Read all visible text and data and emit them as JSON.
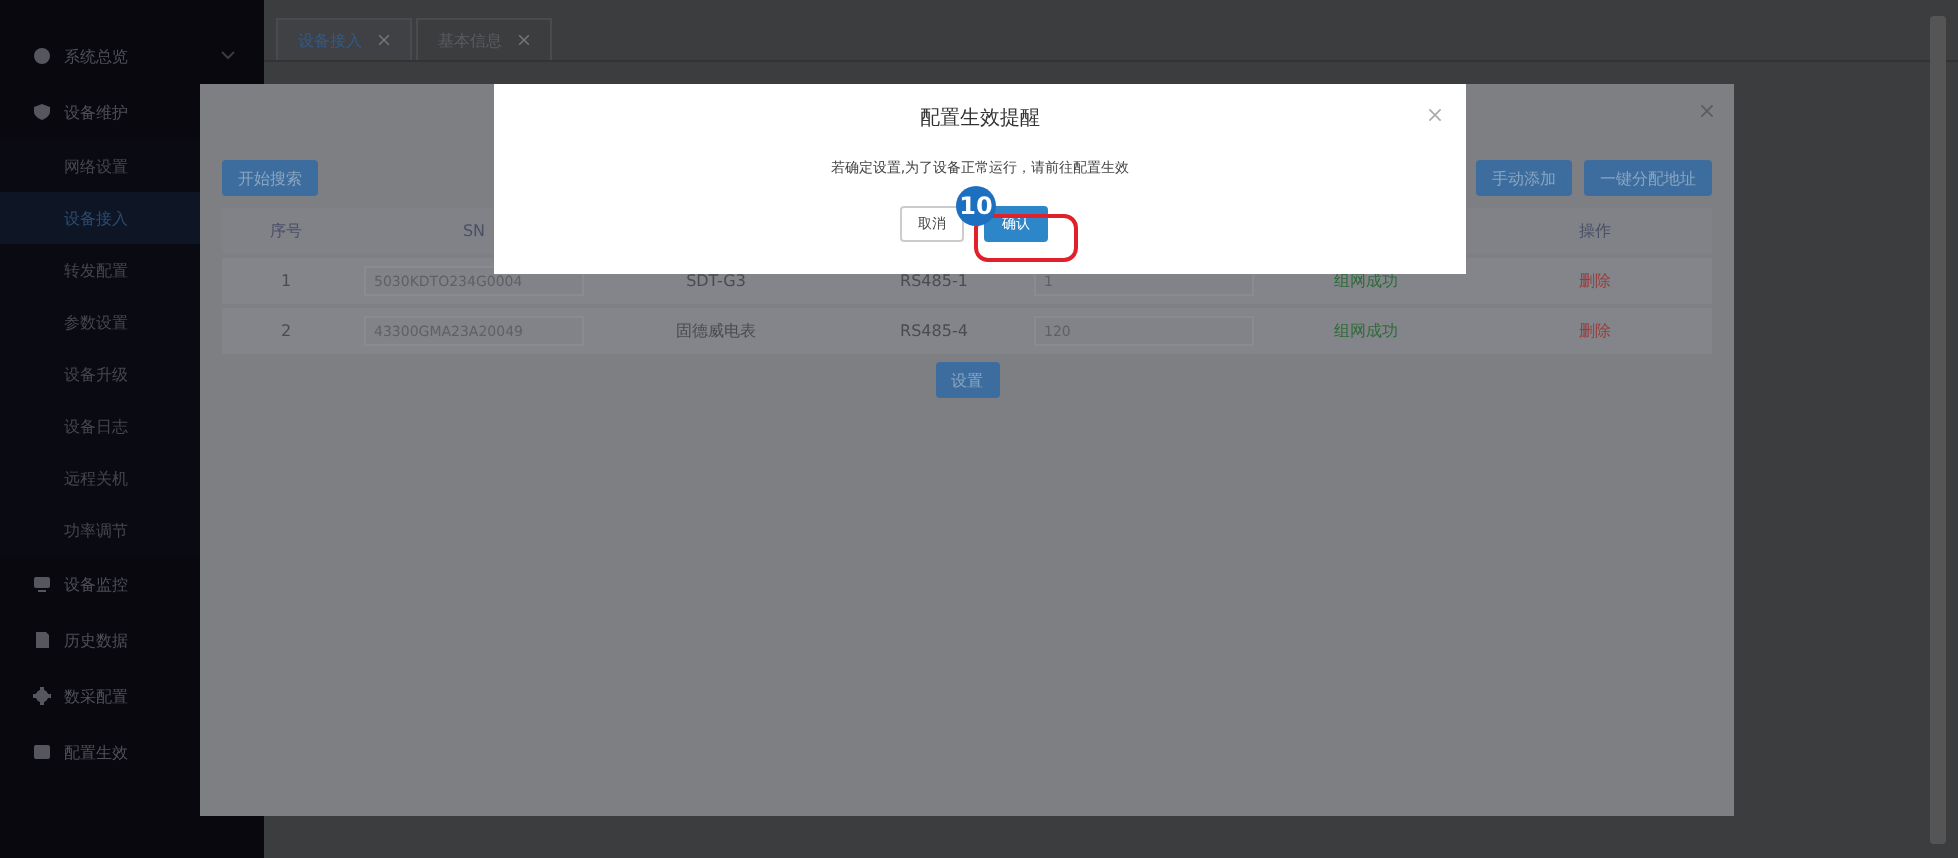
{
  "sidebar": {
    "items": [
      {
        "label": "系统总览"
      },
      {
        "label": "设备维护",
        "children": [
          {
            "label": "网络设置",
            "selected": false
          },
          {
            "label": "设备接入",
            "selected": true
          },
          {
            "label": "转发配置",
            "selected": false
          },
          {
            "label": "参数设置",
            "selected": false
          },
          {
            "label": "设备升级",
            "selected": false
          },
          {
            "label": "设备日志",
            "selected": false
          },
          {
            "label": "远程关机",
            "selected": false
          },
          {
            "label": "功率调节",
            "selected": false
          }
        ]
      },
      {
        "label": "设备监控"
      },
      {
        "label": "历史数据"
      },
      {
        "label": "数采配置"
      },
      {
        "label": "配置生效"
      }
    ]
  },
  "tabs": [
    {
      "label": "设备接入",
      "selected": true
    },
    {
      "label": "基本信息",
      "selected": false
    }
  ],
  "panel": {
    "toolbar_left": [
      "开始搜索"
    ],
    "toolbar_right": [
      "手动添加",
      "一键分配地址"
    ],
    "table": {
      "columns": [
        "序号",
        "SN",
        "",
        "",
        "",
        "",
        "操作"
      ],
      "rows": [
        [
          "1",
          "5030KDTO234G0004",
          "SDT-G3",
          "RS485-1",
          "1",
          "组网成功",
          "删除"
        ],
        [
          "2",
          "43300GMA23A20049",
          "固德威电表",
          "RS485-4",
          "120",
          "组网成功",
          "删除"
        ]
      ]
    },
    "submit": "设置"
  },
  "dialog": {
    "title": "配置生效提醒",
    "message": "若确定设置,为了设备正常运行，请前往配置生效",
    "buttons": [
      {
        "label": "取消",
        "kind": "default"
      },
      {
        "label": "确认",
        "kind": "primary"
      }
    ],
    "step_badge": "10"
  }
}
